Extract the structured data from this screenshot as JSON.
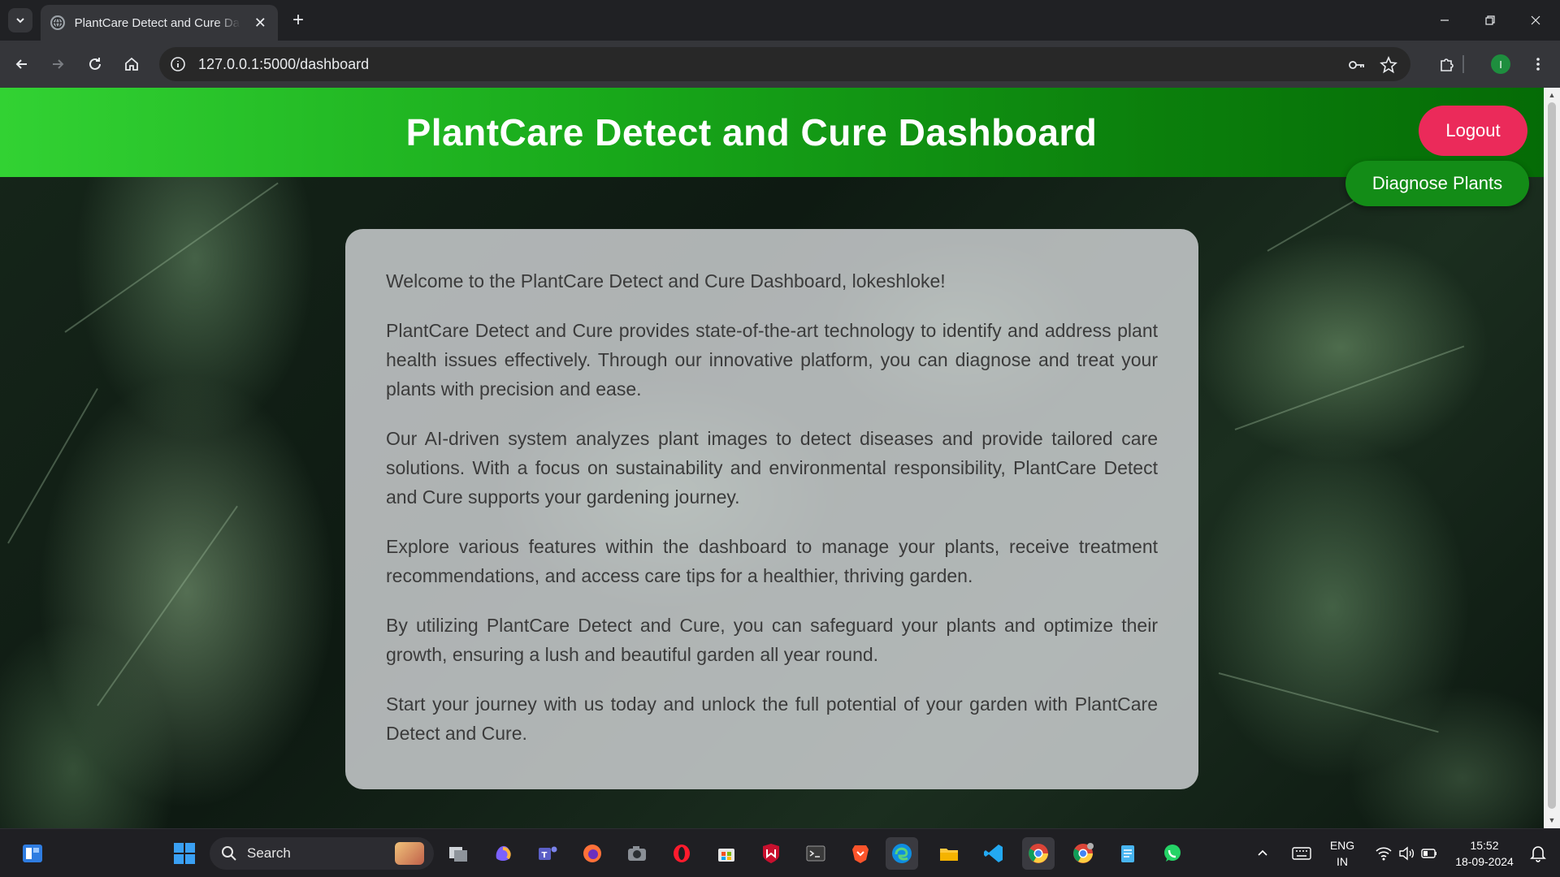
{
  "browser": {
    "tab_title": "PlantCare Detect and Cure Dashboard",
    "url": "127.0.0.1:5000/dashboard",
    "profile_initial": "I"
  },
  "page": {
    "header_title": "PlantCare Detect and Cure Dashboard",
    "logout_label": "Logout",
    "diagnose_label": "Diagnose Plants",
    "paragraphs": [
      "Welcome to the PlantCare Detect and Cure Dashboard, lokeshloke!",
      "PlantCare Detect and Cure provides state-of-the-art technology to identify and address plant health issues effectively. Through our innovative platform, you can diagnose and treat your plants with precision and ease.",
      "Our AI-driven system analyzes plant images to detect diseases and provide tailored care solutions. With a focus on sustainability and environmental responsibility, PlantCare Detect and Cure supports your gardening journey.",
      "Explore various features within the dashboard to manage your plants, receive treatment recommendations, and access care tips for a healthier, thriving garden.",
      "By utilizing PlantCare Detect and Cure, you can safeguard your plants and optimize their growth, ensuring a lush and beautiful garden all year round.",
      "Start your journey with us today and unlock the full potential of your garden with PlantCare Detect and Cure."
    ]
  },
  "taskbar": {
    "search_placeholder": "Search",
    "language_line1": "ENG",
    "language_line2": "IN",
    "time": "15:52",
    "date": "18-09-2024"
  },
  "colors": {
    "header_gradient_start": "#32d233",
    "header_gradient_end": "#056b06",
    "logout_button": "#eb2a5a",
    "diagnose_button": "#138c17"
  }
}
